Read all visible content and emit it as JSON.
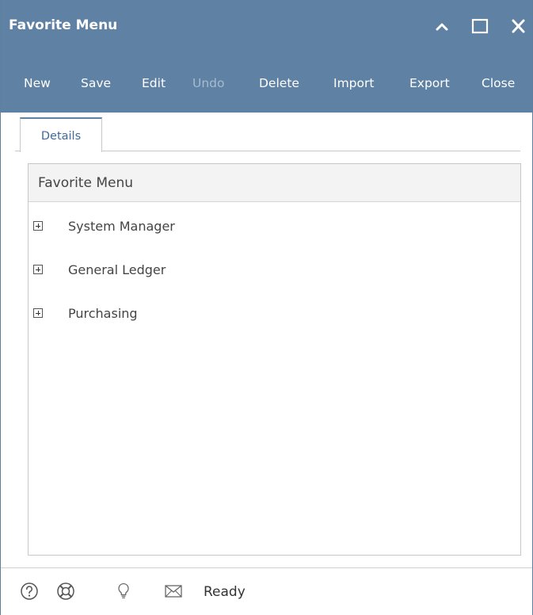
{
  "window": {
    "title": "Favorite Menu",
    "controls": [
      "chevron-up-icon",
      "maximize-icon",
      "close-icon"
    ]
  },
  "toolbar": {
    "buttons": [
      {
        "label": "New",
        "enabled": true
      },
      {
        "label": "Save",
        "enabled": true
      },
      {
        "label": "Edit",
        "enabled": true
      },
      {
        "label": "Undo",
        "enabled": false
      },
      {
        "label": "Delete",
        "enabled": true
      },
      {
        "label": "Import",
        "enabled": true
      },
      {
        "label": "Export",
        "enabled": true
      },
      {
        "label": "Close",
        "enabled": true
      }
    ]
  },
  "tabs": [
    {
      "label": "Details",
      "active": true
    }
  ],
  "panel": {
    "title": "Favorite Menu",
    "items": [
      {
        "label": "System Manager",
        "expanded": false
      },
      {
        "label": "General Ledger",
        "expanded": false
      },
      {
        "label": "Purchasing",
        "expanded": false
      }
    ]
  },
  "statusbar": {
    "icons": [
      "help-icon",
      "support-icon",
      "lightbulb-icon",
      "mail-icon"
    ],
    "status": "Ready"
  },
  "colors": {
    "header_bg": "#5f82a4",
    "header_text": "#ffffff",
    "disabled_text": "#a6bbcf",
    "tab_text": "#3f6b97"
  }
}
